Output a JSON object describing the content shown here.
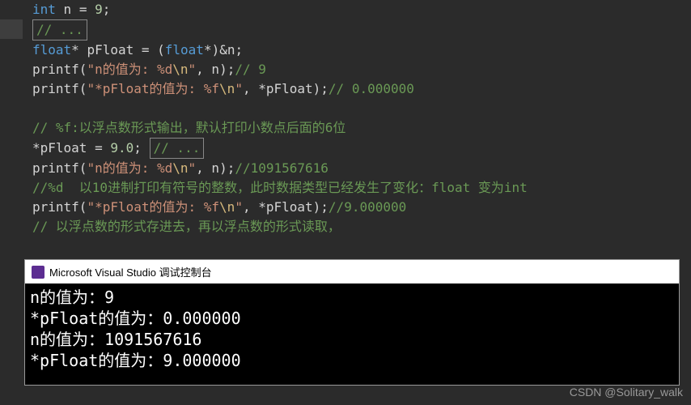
{
  "code": {
    "l1": {
      "kw1": "int",
      "var1": "n",
      "op1": " = ",
      "num1": "9",
      "punc1": ";"
    },
    "l2": {
      "cmt": "// ..."
    },
    "l3": {
      "kw1": "float",
      "var1": "pFloat",
      "op1": " = (",
      "kw2": "float",
      "op2": "*)&",
      "var2": "n",
      "punc1": ";"
    },
    "l4": {
      "fn": "printf",
      "p1": "(",
      "q1": "\"",
      "s1": "n的值为: ",
      "fmt": "%d",
      "esc": "\\n",
      "q2": "\"",
      "c1": ", ",
      "var1": "n",
      "p2": ");",
      "cmt": "// 9"
    },
    "l5": {
      "fn": "printf",
      "p1": "(",
      "q1": "\"",
      "s1": "*pFloat的值为: ",
      "fmt": "%f",
      "esc": "\\n",
      "q2": "\"",
      "c1": ", *",
      "var1": "pFloat",
      "p2": ");",
      "cmt": "// 0.000000"
    },
    "l6": {
      "cmt": "// %f:以浮点数形式输出，默认打印小数点后面的6位"
    },
    "l7": {
      "op1": "*",
      "var1": "pFloat",
      "op2": " = ",
      "num1": "9.0",
      "punc1": ";",
      "cmt": "// ..."
    },
    "l8": {
      "fn": "printf",
      "p1": "(",
      "q1": "\"",
      "s1": "n的值为: ",
      "fmt": "%d",
      "esc": "\\n",
      "q2": "\"",
      "c1": ", ",
      "var1": "n",
      "p2": ");",
      "cmt": "//1091567616"
    },
    "l9": {
      "cmt": "//%d  以10进制打印有符号的整数，此时数据类型已经发生了变化：float 变为int"
    },
    "l10": {
      "fn": "printf",
      "p1": "(",
      "q1": "\"",
      "s1": "*pFloat的值为: ",
      "fmt": "%f",
      "esc": "\\n",
      "q2": "\"",
      "c1": ", *",
      "var1": "pFloat",
      "p2": ");",
      "cmt": "//9.000000"
    },
    "l11": {
      "cmt": "// 以浮点数的形式存进去，再以浮点数的形式读取，"
    }
  },
  "console": {
    "title": "Microsoft Visual Studio 调试控制台",
    "out1": "n的值为：9",
    "out2": "*pFloat的值为：0.000000",
    "out3": "n的值为：1091567616",
    "out4": "*pFloat的值为：9.000000"
  },
  "watermark": "CSDN @Solitary_walk"
}
